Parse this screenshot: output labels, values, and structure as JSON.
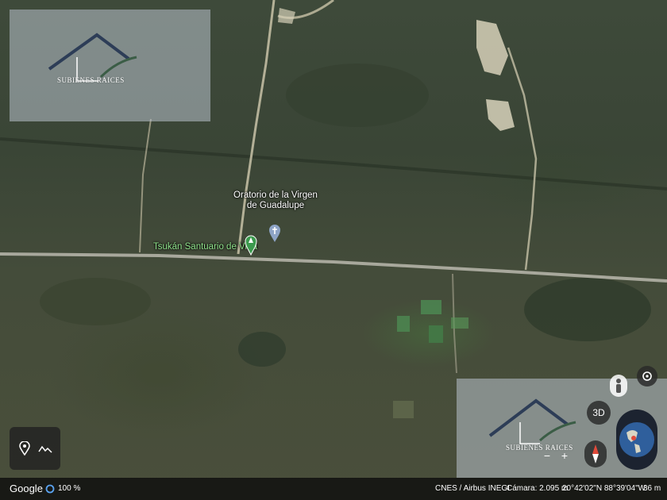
{
  "map": {
    "places": [
      {
        "name_line1": "Oratorio de la Virgen",
        "name_line2": "de Guadalupe",
        "icon": "church-pin-icon"
      },
      {
        "name": "Tsukán Santuario de Vida",
        "icon": "park-pin-icon"
      }
    ],
    "watermark_brand": "SUBIENES RAICES"
  },
  "controls": {
    "view_3d_label": "3D",
    "zoom_in_label": "+",
    "zoom_out_label": "−",
    "icons": [
      "location-icon",
      "pegman-icon",
      "compass-icon",
      "globe-icon",
      "pin-icon",
      "terrain-icon"
    ]
  },
  "status_bar": {
    "brand": "Google",
    "zoom": "100 %",
    "attribution": "CNES / Airbus  INEGI",
    "camera": "Cámara: 2.095 m",
    "coordinates": "20°42'02\"N 88°39'04\"W",
    "scale": "36 m"
  }
}
